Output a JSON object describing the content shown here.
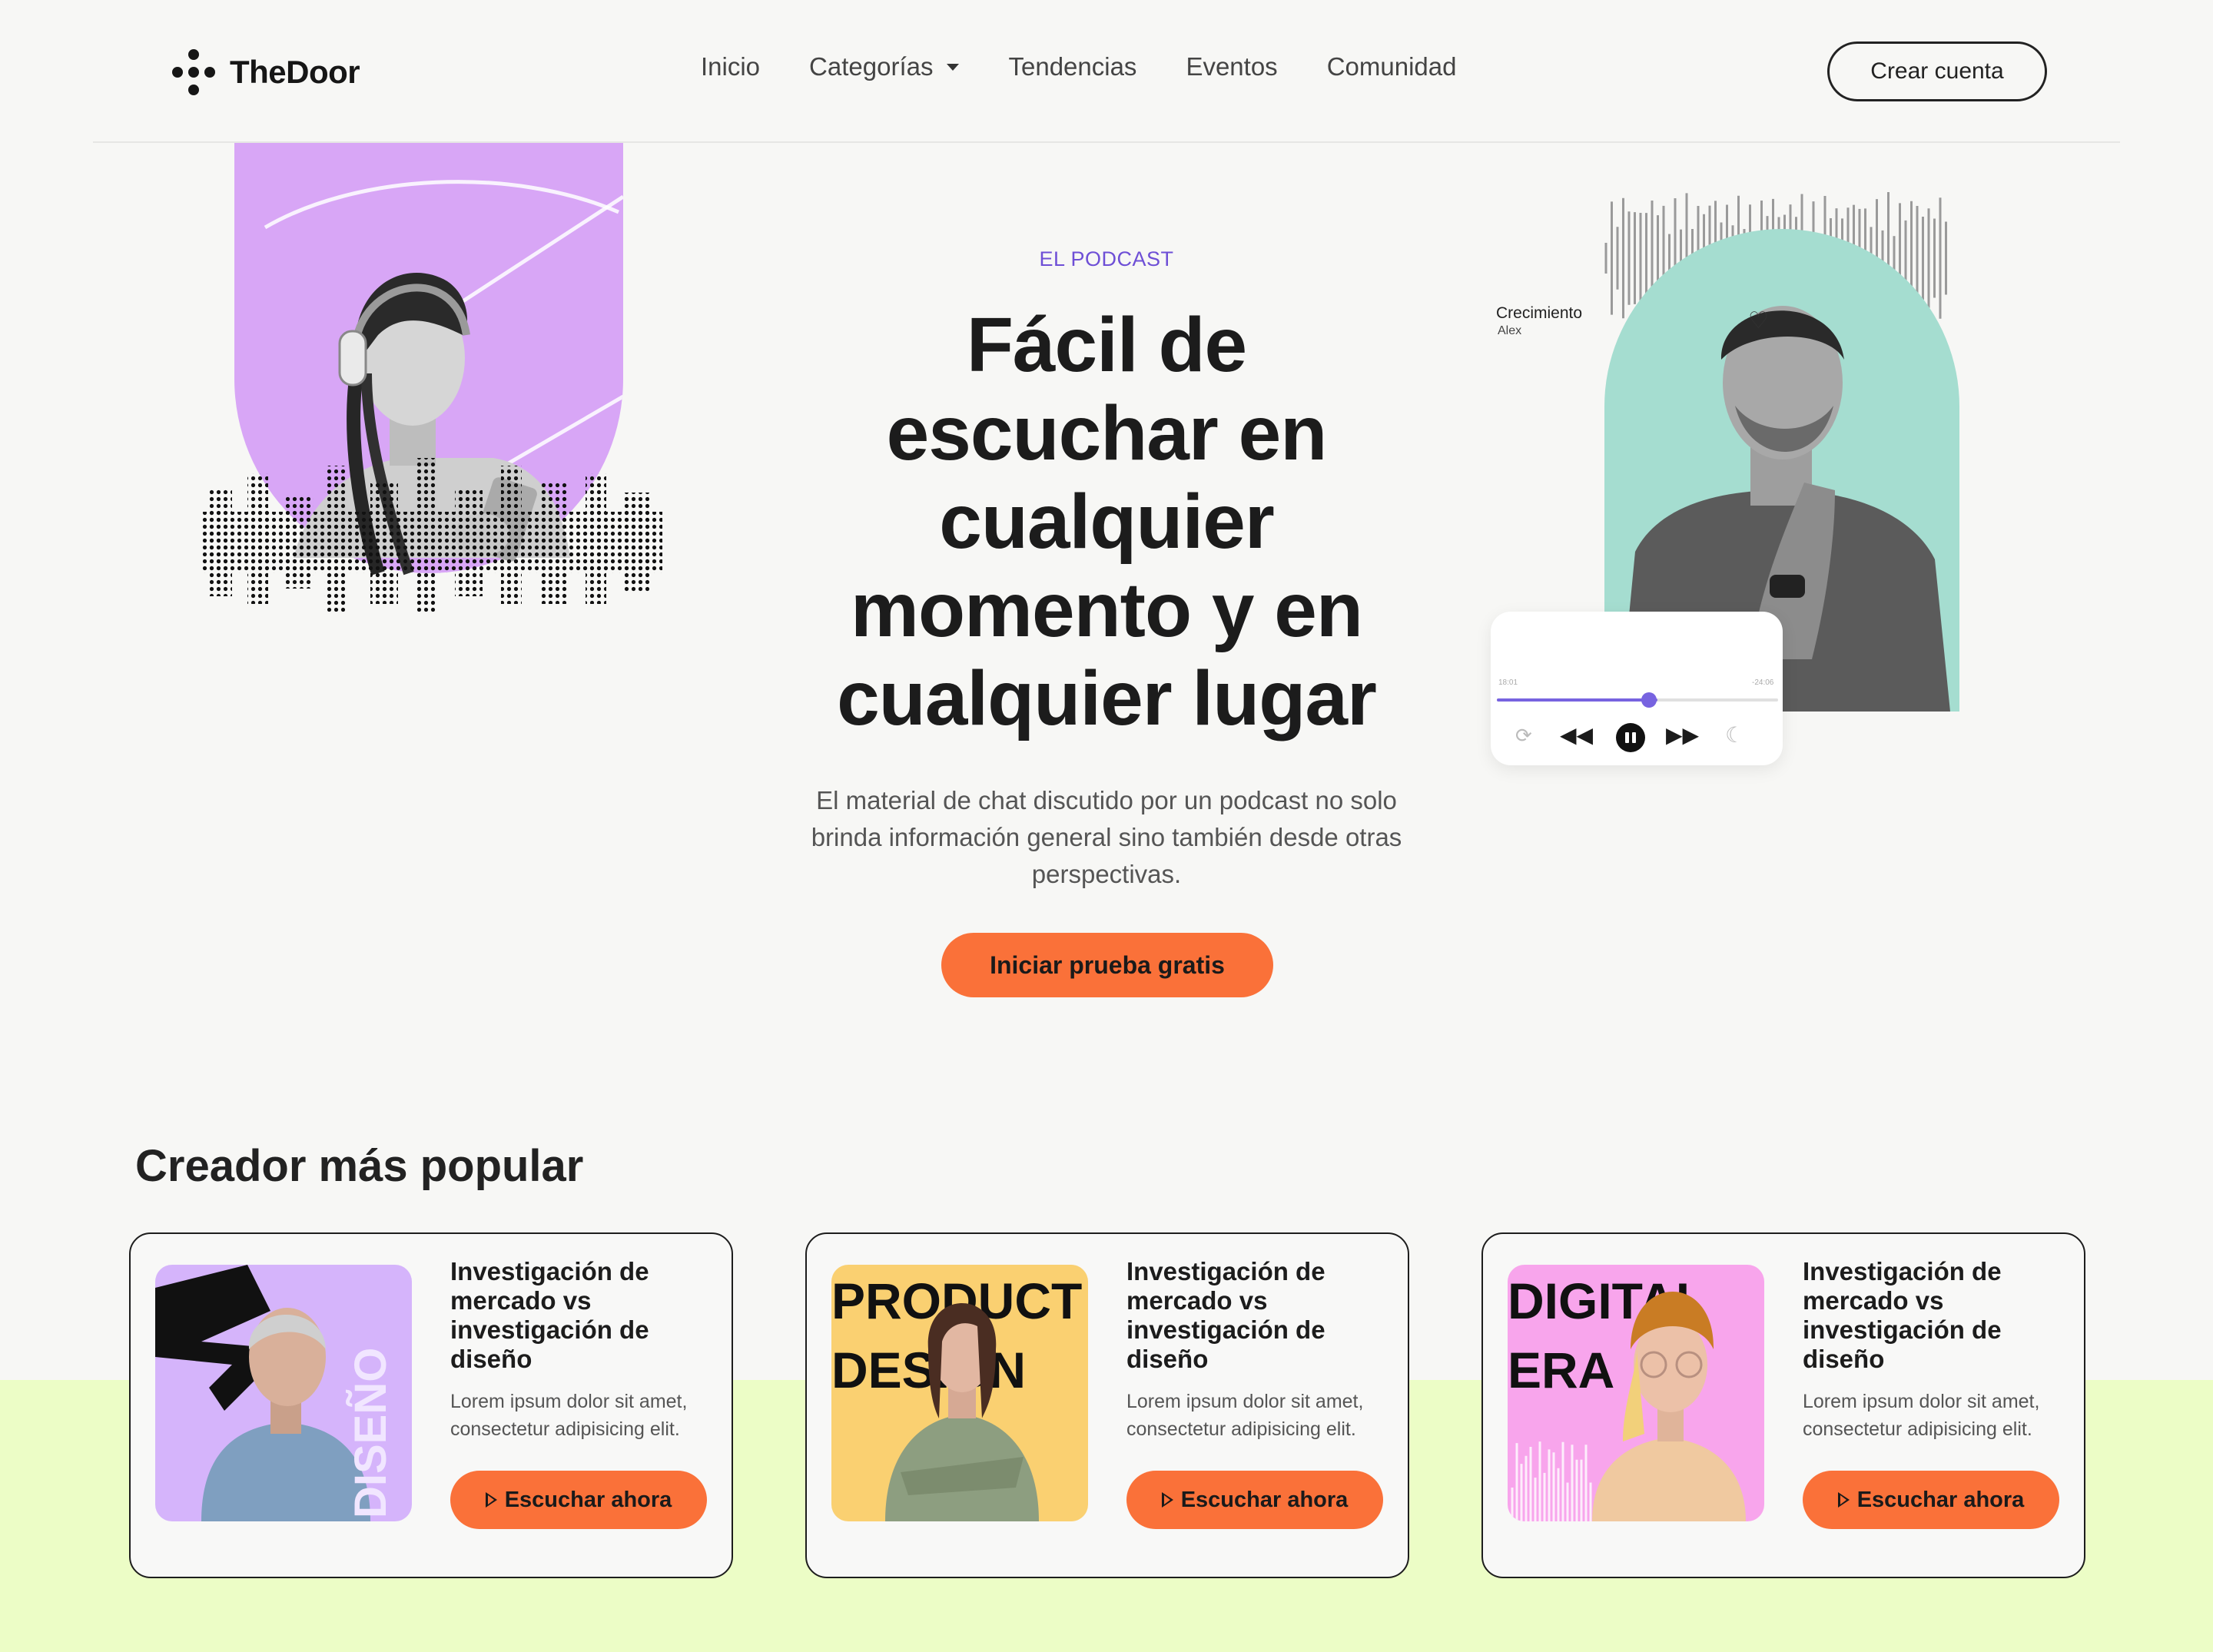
{
  "brand": {
    "name": "TheDoor"
  },
  "nav": {
    "links": [
      "Inicio",
      "Categorías",
      "Tendencias",
      "Eventos",
      "Comunidad"
    ],
    "cta": "Crear cuenta"
  },
  "hero": {
    "eyebrow": "EL PODCAST",
    "title": "Fácil de escuchar en cualquier momento y en cualquier lugar",
    "description": "El material de chat discutido por un podcast no solo brinda información general sino también desde otras perspectivas.",
    "cta": "Iniciar prueba gratis"
  },
  "player": {
    "title": "Crecimiento",
    "artist": "Alex",
    "elapsed": "18:01",
    "remaining": "-24:06",
    "progress": 0.57
  },
  "popular": {
    "heading": "Creador más popular",
    "cards": [
      {
        "title": "Investigación de mercado vs investigación de diseño",
        "desc": "Lorem ipsum dolor sit amet, consectetur adipisicing elit.",
        "button": "Escuchar ahora",
        "image_text": "DISEÑO"
      },
      {
        "title": "Investigación de mercado vs investigación de diseño",
        "desc": "Lorem ipsum dolor sit amet, consectetur adipisicing elit.",
        "button": "Escuchar ahora",
        "image_text": "PRODUCT DESIGN"
      },
      {
        "title": "Investigación de mercado vs investigación de diseño",
        "desc": "Lorem ipsum dolor sit amet, consectetur adipisicing elit.",
        "button": "Escuchar ahora",
        "image_text": "DIGITAL ERA"
      }
    ]
  },
  "colors": {
    "accent_orange": "#fa7139",
    "eyebrow_purple": "#6e4fd6",
    "arch_purple": "#d8a6f6",
    "arch_teal": "#a5ddd0",
    "band_green": "#ecfdc6",
    "card1_bg": "#d5b4fb",
    "card2_bg": "#fad071",
    "card3_bg": "#f8a5ec"
  },
  "icons": [
    "logo-dots-icon",
    "chevron-down-icon",
    "heart-icon",
    "repeat-icon",
    "rewind-icon",
    "pause-icon",
    "fast-forward-icon",
    "moon-icon",
    "play-icon"
  ]
}
